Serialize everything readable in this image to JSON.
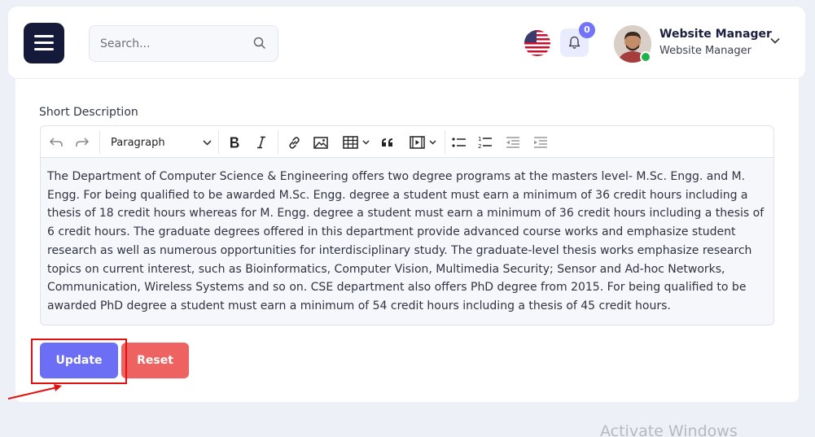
{
  "header": {
    "search_placeholder": "Search...",
    "notification_count": "0",
    "user_name": "Website Manager",
    "user_role": "Website Manager"
  },
  "form": {
    "short_description_label": "Short Description",
    "toolbar": {
      "paragraph_format": "Paragraph",
      "icons": [
        "undo-icon",
        "redo-icon",
        "bold-icon",
        "italic-icon",
        "link-icon",
        "image-icon",
        "table-icon",
        "blockquote-icon",
        "media-icon",
        "bulleted-list-icon",
        "numbered-list-icon",
        "outdent-icon",
        "indent-icon"
      ]
    },
    "content": "The Department of Computer Science & Engineering offers two degree programs at the masters level- M.Sc. Engg. and M. Engg. For being qualified to be awarded M.Sc. Engg. degree a student must earn a minimum of 36 credit hours including a thesis of 18 credit hours whereas for M. Engg. degree a student must earn a minimum of 36 credit hours including a thesis of 6 credit hours. The graduate degrees offered in this department provide advanced course works and emphasize student research as well as numerous opportunities for interdisciplinary study. The graduate-level thesis works emphasize research topics on current interest, such as Bioinformatics, Computer Vision, Multimedia Security; Sensor and Ad-hoc Networks, Communication, Wireless Systems and so on. CSE department also offers PhD degree from 2015. For being qualified to be awarded PhD degree a student must earn a minimum of 54 credit hours including a thesis of 45 credit hours.",
    "update_label": "Update",
    "reset_label": "Reset"
  },
  "watermark": "Activate Windows",
  "colors": {
    "primary": "#6c6ff5",
    "danger": "#ef6262",
    "menu_bg": "#151a3a",
    "annotation": "#e31010"
  }
}
